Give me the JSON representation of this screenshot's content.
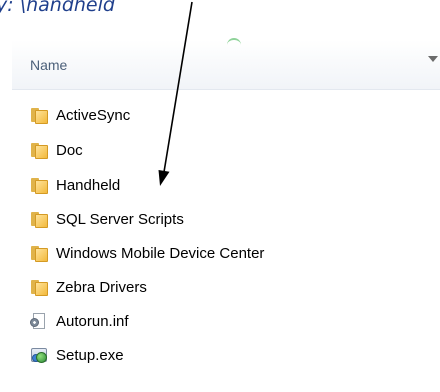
{
  "caption": {
    "text": "y:  \\handheld"
  },
  "header": {
    "name_label": "Name"
  },
  "items": [
    {
      "label": "ActiveSync",
      "type": "folder"
    },
    {
      "label": "Doc",
      "type": "folder"
    },
    {
      "label": "Handheld",
      "type": "folder"
    },
    {
      "label": "SQL Server Scripts",
      "type": "folder"
    },
    {
      "label": "Windows Mobile Device Center",
      "type": "folder"
    },
    {
      "label": "Zebra Drivers",
      "type": "folder"
    },
    {
      "label": "Autorun.inf",
      "type": "inf-file"
    },
    {
      "label": "Setup.exe",
      "type": "exe-file"
    }
  ],
  "colors": {
    "folder": "#f2b93c",
    "caption": "#1f3f8c",
    "header_text": "#4c607a"
  }
}
